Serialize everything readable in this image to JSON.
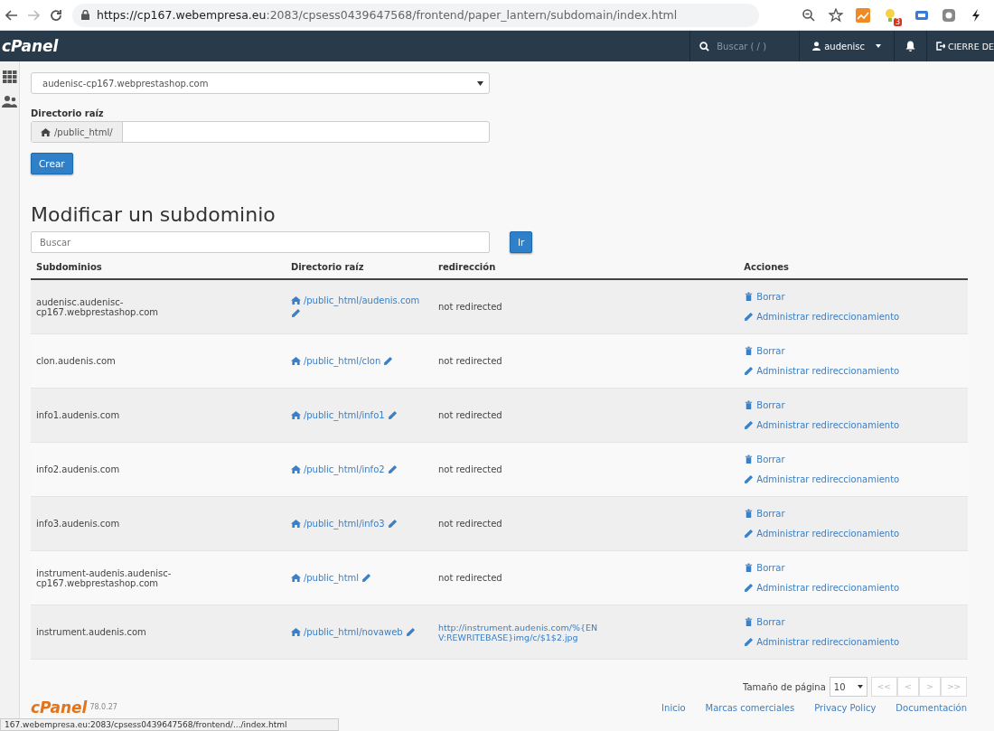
{
  "browser": {
    "url_host": "https://cp167.webempresa.eu",
    "url_rest": ":2083/cpsess0439647568/frontend/paper_lantern/subdomain/index.html",
    "extension_badge": "3"
  },
  "header": {
    "logo": "cPanel",
    "search_placeholder": "Buscar ( / )",
    "user": "audenisc",
    "logout": "CIERRE DE"
  },
  "create_form": {
    "domain_value": "audenisc-cp167.webprestashop.com",
    "root_label": "Directorio raíz",
    "root_prefix": "/public_html/",
    "create_button": "Crear"
  },
  "modify": {
    "title": "Modificar un subdominio",
    "search_placeholder": "Buscar",
    "go_button": "Ir"
  },
  "table": {
    "columns": [
      "Subdominios",
      "Directorio raíz",
      "redirección",
      "Acciones"
    ],
    "rows": [
      {
        "subdomain": "audenisc.audenisc-cp167.webprestashop.com",
        "root": "/public_html/audenis.com",
        "redirect": "not redirected",
        "redirect_link": false,
        "delete": "Borrar",
        "manage": "Administrar redireccionamiento"
      },
      {
        "subdomain": "clon.audenis.com",
        "root": "/public_html/clon",
        "redirect": "not redirected",
        "redirect_link": false,
        "delete": "Borrar",
        "manage": "Administrar redireccionamiento"
      },
      {
        "subdomain": "info1.audenis.com",
        "root": "/public_html/info1",
        "redirect": "not redirected",
        "redirect_link": false,
        "delete": "Borrar",
        "manage": "Administrar redireccionamiento"
      },
      {
        "subdomain": "info2.audenis.com",
        "root": "/public_html/info2",
        "redirect": "not redirected",
        "redirect_link": false,
        "delete": "Borrar",
        "manage": "Administrar redireccionamiento"
      },
      {
        "subdomain": "info3.audenis.com",
        "root": "/public_html/info3",
        "redirect": "not redirected",
        "redirect_link": false,
        "delete": "Borrar",
        "manage": "Administrar redireccionamiento"
      },
      {
        "subdomain": "instrument-audenis.audenisc-cp167.webprestashop.com",
        "root": "/public_html",
        "redirect": "not redirected",
        "redirect_link": false,
        "delete": "Borrar",
        "manage": "Administrar redireccionamiento"
      },
      {
        "subdomain": "instrument.audenis.com",
        "root": "/public_html/novaweb",
        "redirect": "http://instrument.audenis.com/%{ENV:REWRITEBASE}img/c/$1$2.jpg",
        "redirect_link": true,
        "delete": "Borrar",
        "manage": "Administrar redireccionamiento"
      }
    ]
  },
  "pagination": {
    "label": "Tamaño de página",
    "page_size": "10",
    "buttons": [
      "<<",
      "<",
      ">",
      ">>"
    ]
  },
  "footer": {
    "logo": "cPanel",
    "version": "78.0.27",
    "links": [
      "Inicio",
      "Marcas comerciales",
      "Privacy Policy",
      "Documentación"
    ]
  },
  "status_url": "167.webempresa.eu:2083/cpsess0439647568/frontend/.../index.html"
}
